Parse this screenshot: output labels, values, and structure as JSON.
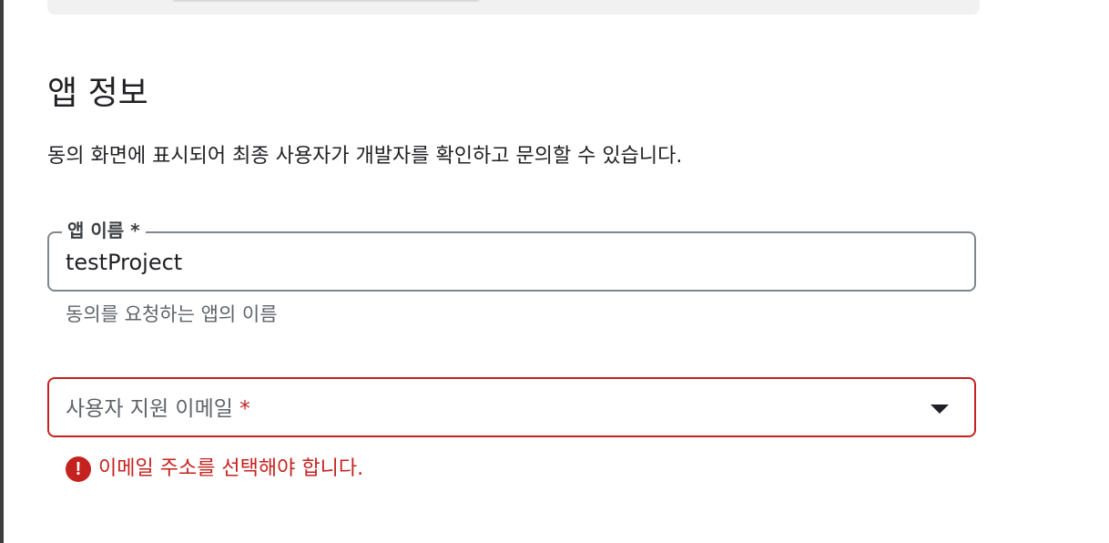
{
  "section": {
    "title": "앱 정보",
    "description": "동의 화면에 표시되어 최종 사용자가 개발자를 확인하고 문의할 수 있습니다."
  },
  "app_name_field": {
    "label": "앱 이름 *",
    "value": "testProject",
    "helper": "동의를 요청하는 앱의 이름"
  },
  "support_email_field": {
    "placeholder": "사용자 지원 이메일",
    "required_marker": "*",
    "error_icon_glyph": "!",
    "error": "이메일 주소를 선택해야 합니다."
  },
  "colors": {
    "error": "#c5221f",
    "outline": "#80868b",
    "text": "#202124",
    "secondary_text": "#5f6368"
  },
  "icons": {
    "dropdown": "arrow-drop-down-icon",
    "error": "error-icon"
  }
}
